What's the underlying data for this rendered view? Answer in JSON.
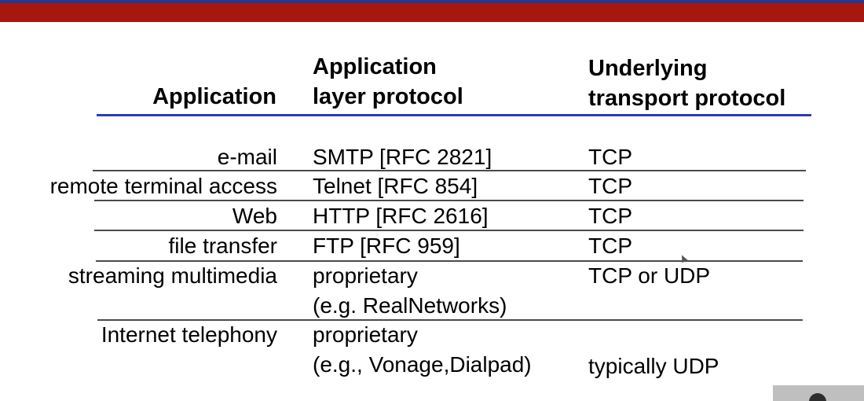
{
  "headers": {
    "application": "Application",
    "app_layer_protocol_line1": "Application",
    "app_layer_protocol_line2": "layer protocol",
    "transport_protocol_line1": "Underlying",
    "transport_protocol_line2": "transport protocol"
  },
  "rows": [
    {
      "application": "e-mail",
      "protocol": [
        "SMTP [RFC 2821]"
      ],
      "transport": "TCP"
    },
    {
      "application": "remote terminal access",
      "protocol": [
        "Telnet [RFC 854]"
      ],
      "transport": "TCP"
    },
    {
      "application": "Web",
      "protocol": [
        "HTTP [RFC 2616]"
      ],
      "transport": "TCP"
    },
    {
      "application": "file transfer",
      "protocol": [
        "FTP [RFC 959]"
      ],
      "transport": "TCP"
    },
    {
      "application": "streaming multimedia",
      "protocol": [
        "proprietary",
        "(e.g. RealNetworks)"
      ],
      "transport": "TCP or UDP"
    },
    {
      "application": "Internet telephony",
      "protocol": [
        "proprietary",
        "(e.g., Vonage,Dialpad)"
      ],
      "transport": "typically UDP"
    }
  ],
  "colors": {
    "top_band": "#a6170f",
    "top_strip": "#1f3a93",
    "header_rule": "#2a3eb1",
    "row_rule": "#4a4a4a"
  }
}
